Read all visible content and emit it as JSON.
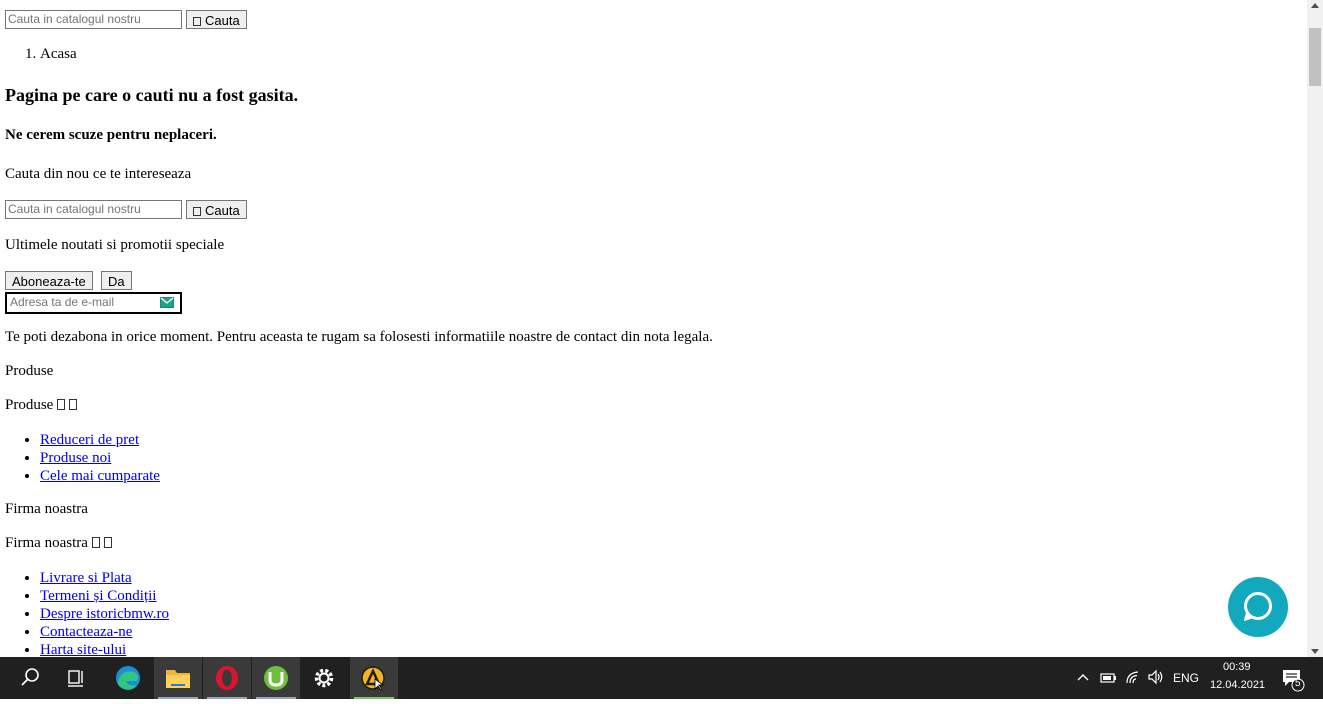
{
  "top_search": {
    "placeholder": "Cauta in catalogul nostru",
    "button_label": "Cauta"
  },
  "breadcrumb": {
    "items": [
      "Acasa"
    ]
  },
  "not_found": {
    "title": "Pagina pe care o cauti nu a fost gasita.",
    "subtitle": "Ne cerem scuze pentru neplaceri.",
    "prompt": "Cauta din nou ce te intereseaza"
  },
  "mid_search": {
    "placeholder": "Cauta in catalogul nostru",
    "button_label": "Cauta"
  },
  "newsletter": {
    "heading": "Ultimele noutati si promotii speciale",
    "subscribe_label": "Aboneaza-te",
    "yes_label": "Da",
    "email_placeholder": "Adresa ta de e-mail",
    "disclaimer": "Te poti dezabona in orice moment. Pentru aceasta te rugam sa folosesti informatiile noastre de contact din nota legala."
  },
  "footer": {
    "products": {
      "title": "Produse",
      "toggle_title": "Produse",
      "links": [
        "Reduceri de pret",
        "Produse noi",
        "Cele mai cumparate"
      ]
    },
    "company": {
      "title": "Firma noastra",
      "toggle_title": "Firma noastra",
      "links": [
        "Livrare si Plata",
        "Termeni și Condiții",
        "Despre istoricbmw.ro",
        "Contacteaza-ne",
        "Harta site-ului"
      ]
    }
  },
  "colors": {
    "link": "#0000ee",
    "chat_bubble": "#12a9be",
    "taskbar": "#202020"
  },
  "taskbar": {
    "apps": [
      "search-icon",
      "task-view-icon",
      "edge-icon",
      "file-explorer-icon",
      "opera-icon",
      "utorrent-icon",
      "settings-icon",
      "app-icon"
    ],
    "tray": {
      "language": "ENG",
      "time": "00:39",
      "date": "12.04.2021",
      "notifications": "5"
    }
  }
}
